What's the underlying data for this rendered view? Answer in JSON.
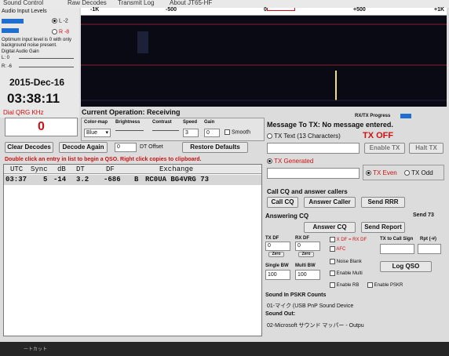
{
  "menu": [
    "Sound Control",
    "Raw Decodes",
    "Transmit Log",
    "About JT65-HF"
  ],
  "spectrum_scale": {
    "labels": [
      "-1K",
      "-500",
      "0",
      "+500",
      "+1K"
    ]
  },
  "left_panel": {
    "audio_input_label": "Audio Input Levels",
    "l_radio": "L -2",
    "r_radio": "R -8",
    "notice": "Optimum input level is 0 with only background noise present.",
    "digital_gain_label": "Digital Audio Gain",
    "l_gain": "L: 0",
    "r_gain": "R: -6",
    "date": "2015-Dec-16",
    "time": "03:38:11",
    "dial_qrg_label": "Dial QRG KHz",
    "dial_qrg_value": "0"
  },
  "current_operation": {
    "label": "Current Operation:",
    "value": "Receiving"
  },
  "rxtx_progress_label": "RX/TX Progress",
  "controls": {
    "colormap_label": "Color-map",
    "colormap_value": "Blue",
    "brightness_label": "Brightness",
    "contrast_label": "Contrast",
    "speed_label": "Speed",
    "speed_value": "3",
    "gain_label": "Gain",
    "gain_value": "0",
    "smooth_label": "Smooth"
  },
  "buttons": {
    "clear_decodes": "Clear Decodes",
    "decode_again": "Decode Again",
    "dt_offset_label": "DT Offset",
    "dt_offset_value": "0",
    "restore_defaults": "Restore Defaults",
    "enable_tx": "Enable TX",
    "halt_tx": "Halt TX",
    "call_cq": "Call CQ",
    "answer_caller": "Answer Caller",
    "send_rrr": "Send RRR",
    "answer_cq": "Answer CQ",
    "send_report": "Send Report",
    "log_qso": "Log QSO"
  },
  "hint": "Double click an entry in list to begin a QSO.  Right click copies to clipboard.",
  "decode_table": {
    "headers": [
      "UTC",
      "Sync",
      "dB",
      "DT",
      "DF",
      "Exchange"
    ],
    "rows": [
      {
        "utc": "03:37",
        "sync": "5",
        "db": "-14",
        "dt": "3.2",
        "df": "-686",
        "mode": "B",
        "exchange": "RC0UA BG4VRG 73"
      }
    ]
  },
  "tx": {
    "message_label": "Message To TX:",
    "message_value": "No message entered.",
    "tx_text_label": "TX Text (13 Characters)",
    "tx_status": "TX OFF",
    "tx_generated_label": "TX Generated",
    "tx_even": "TX Even",
    "tx_odd": "TX Odd"
  },
  "cq_section": {
    "call_label": "Call CQ and answer callers",
    "answering_label": "Answering CQ",
    "send73_label": "Send 73"
  },
  "df_section": {
    "tx_df_label": "TX DF",
    "tx_df_value": "0",
    "rx_df_label": "RX DF",
    "rx_df_value": "0",
    "zero_label": "Zero",
    "x_df_rx_df": "X DF = RX DF",
    "afc_label": "AFC",
    "noise_blank_label": "Noise Blank",
    "enable_multi_label": "Enable Multi",
    "enable_rb_label": "Enable RB",
    "enable_pskr_label": "Enable PSKR",
    "tx_to_call_label": "TX to Call Sign",
    "rpt_label": "Rpt (-#)",
    "single_bw_label": "Single BW",
    "single_bw_value": "100",
    "multi_bw_label": "Multi BW",
    "multi_bw_value": "100"
  },
  "sound": {
    "counts_label": "Sound In PSKR Counts",
    "input_device": "01-マイク (USB PnP Sound Device",
    "output_label": "Sound Out:",
    "output_device": "02-Microsoft サウンド マッパー - Outpu"
  },
  "status_bar": {
    "left_text": "ートカット"
  },
  "colors": {
    "accent": "#1f6fd0",
    "alert": "#d01010",
    "waterfall_bg": "#0a0a14"
  }
}
